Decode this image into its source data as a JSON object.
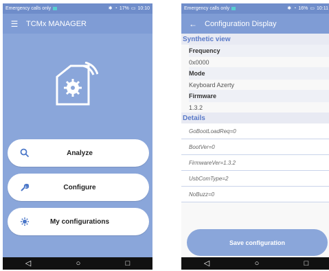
{
  "left": {
    "status": {
      "left_text": "Emergency calls only",
      "right_text": "17%",
      "time": "10:10"
    },
    "app_title": "TCMx MANAGER",
    "buttons": [
      {
        "label": "Analyze",
        "icon": "search-icon"
      },
      {
        "label": "Configure",
        "icon": "wrench-icon"
      },
      {
        "label": "My configurations",
        "icon": "gear-icon"
      }
    ]
  },
  "right": {
    "status": {
      "left_text": "Emergency calls only",
      "right_text": "16%",
      "time": "10:11"
    },
    "app_title": "Configuration Display",
    "sections": {
      "synthetic_view": "Synthetic view",
      "details": "Details"
    },
    "synthetic": [
      {
        "label": "Frequency",
        "value": "0x0000"
      },
      {
        "label": "Mode",
        "value": "Keyboard Azerty"
      },
      {
        "label": "Firmware",
        "value": "1.3.2"
      }
    ],
    "details": [
      "GoBootLoadReq=0",
      "BootVer=0",
      "FirmwareVer=1.3.2",
      "UsbComType=2",
      "NoBuzz=0"
    ],
    "save_label": "Save configuration"
  }
}
